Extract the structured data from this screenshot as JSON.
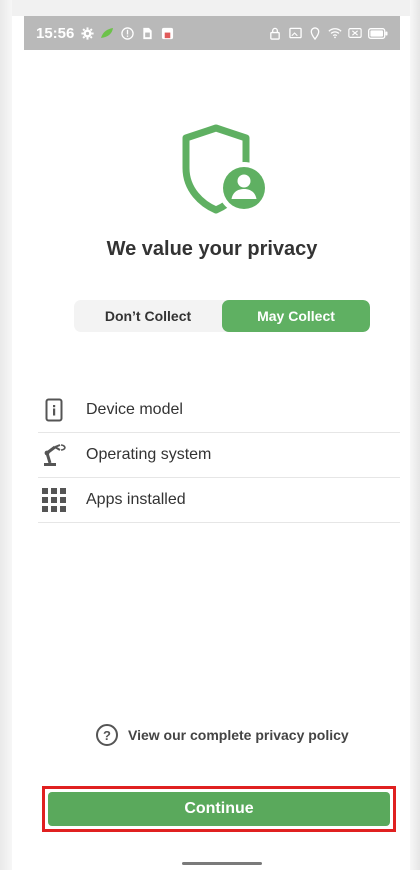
{
  "status_bar": {
    "time": "15:56",
    "left_icons": [
      "gear-icon",
      "leaf-icon",
      "alert-icon",
      "sim-icon",
      "app-icon"
    ],
    "right_icons": [
      "lock-icon",
      "cast-icon",
      "location-icon",
      "wifi-icon",
      "no-sim-icon",
      "battery-icon"
    ]
  },
  "header": {
    "icon": "shield-user-icon",
    "title": "We value your privacy"
  },
  "toggle": {
    "options": [
      {
        "label": "Don’t Collect",
        "selected": false
      },
      {
        "label": "May Collect",
        "selected": true
      }
    ]
  },
  "data_items": [
    {
      "icon": "phone-info-icon",
      "label": "Device model"
    },
    {
      "icon": "robot-arm-icon",
      "label": "Operating system"
    },
    {
      "icon": "apps-grid-icon",
      "label": "Apps installed"
    }
  ],
  "policy_link": {
    "icon": "help-circle-icon",
    "label": "View our complete privacy policy"
  },
  "actions": {
    "continue_label": "Continue"
  },
  "colors": {
    "accent": "#5fb062",
    "status_bar": "#b9b9b9",
    "highlight_border": "#e02020"
  }
}
